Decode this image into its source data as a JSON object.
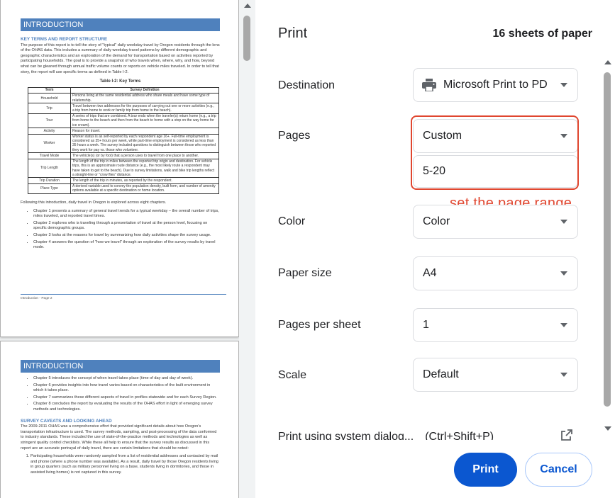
{
  "dialog": {
    "title": "Print",
    "sheets": "16 sheets of paper"
  },
  "settings": {
    "destination": {
      "label": "Destination",
      "value": "Microsoft Print to PD"
    },
    "pages": {
      "label": "Pages",
      "value": "Custom",
      "range": "5-20"
    },
    "color": {
      "label": "Color",
      "value": "Color"
    },
    "paper_size": {
      "label": "Paper size",
      "value": "A4"
    },
    "pages_per_sheet": {
      "label": "Pages per sheet",
      "value": "1"
    },
    "scale": {
      "label": "Scale",
      "value": "Default"
    },
    "system_dialog": {
      "label": "Print using system dialog...",
      "shortcut": "(Ctrl+Shift+P)"
    }
  },
  "annotation": {
    "text": "set the page range",
    "color": "#e0462f"
  },
  "buttons": {
    "print": "Print",
    "cancel": "Cancel"
  },
  "colors": {
    "accent": "#0b57d0",
    "doc_heading": "#4f81bd"
  },
  "preview": {
    "page1": {
      "banner": "INTRODUCTION",
      "heading": "KEY TERMS AND REPORT STRUCTURE",
      "para1": "The purpose of this report is to tell the story of \"typical\" daily weekday travel by Oregon residents through the lens of the OHAS data. This includes a summary of daily weekday travel patterns by different demographic and geographic characteristics and an exploration of the demand for transportation based on activities reported by participating households. The goal is to provide a snapshot of who travels when, where, why, and how, beyond what can be gleaned through annual traffic volume counts or reports on vehicle miles traveled. In order to tell that story, the report will use specific terms as defined in Table I-2.",
      "table_caption": "Table I-2:  Key Terms",
      "table_headers": [
        "Term",
        "Survey Definition"
      ],
      "table_rows": [
        [
          "Household",
          "Persons living at the same residential address who share meals and have some type of relationship."
        ],
        [
          "Trip",
          "Travel between two addresses for the purposes of carrying out one or more activities (e.g., a trip from home to work or family trip from home to the beach)."
        ],
        [
          "Tour",
          "A series of trips that are combined. A tour ends when the traveler(s) return home (e.g., a trip from home to the beach and then from the beach to home with a stop on the way home for ice cream)."
        ],
        [
          "Activity",
          "Reason for travel."
        ],
        [
          "Worker",
          "Worker status is as self-reported by each respondent age 16+. Full-time employment is considered as 35+ hours per week, while part-time employment is considered as less than 35 hours a week. The survey included questions to distinguish between those who reported they work for pay vs. those who volunteer."
        ],
        [
          "Travel Mode",
          "The vehicle(s) (or by foot) that a person uses to travel from one place to another."
        ],
        [
          "Trip Length",
          "The length of the trip in miles between the reported trip origin and destination. For vehicle trips, this is an approximate route distance (e.g., the most likely route a respondent may have taken to get to the beach). Due to survey limitations, walk and bike trip lengths reflect a straight-line or \"crow flies\" distance."
        ],
        [
          "Trip Duration",
          "The length of the trip in minutes, as reported by the respondent."
        ],
        [
          "Place Type",
          "A derived variable used to convey the population density, built form, and number of amenity options available at a specific destination or home location."
        ]
      ],
      "para2": "Following this introduction, daily travel in Oregon is explored across eight chapters.",
      "bullets": [
        "Chapter 1 presents a summary of general travel trends for a typical weekday – the overall number of trips, miles traveled, and reported travel times.",
        "Chapter 2 explores who is traveling through a presentation of travel at the person level, focusing on specific demographic groups.",
        "Chapter 3 looks at the reasons for travel by summarizing how daily activities shape the survey usage.",
        "Chapter 4 answers the question of \"how we travel\" through an exploration of the survey results by travel mode."
      ],
      "footer": "Introduction - Page 2"
    },
    "page2": {
      "banner": "INTRODUCTION",
      "bullets": [
        "Chapter 5 introduces the concept of when travel takes place (time of day and day of week).",
        "Chapter 6 provides insights into how travel varies based on characteristics of the built environment in which it takes place.",
        "Chapter 7 summarizes these different aspects of travel in profiles statewide and for each Survey Region.",
        "Chapter 8 concludes the report by evaluating the results of the OHAS effort in light of emerging survey methods and technologies."
      ],
      "heading": "SURVEY CAVEATS AND LOOKING AHEAD",
      "para1": "The 2009-2011 OHAS was a comprehensive effort that provided significant details about how Oregon's transportation infrastructure is used. The survey methods, sampling, and post-processing of the data conformed to industry standards. These included the use of state-of-the-practice methods and technologies as well as stringent quality control checklists. While these all help to ensure that the survey results as discussed in this report are an accurate portrayal of daily travel, there are certain limitations that should be noted:",
      "numbered": [
        "Participating households were randomly sampled from a list of residential addresses and contacted by mail and phone (where a phone number was available). As a result, daily travel by those Oregon residents living in group quarters (such as military personnel living on a base, students living in dormitories, and those in assisted living homes) is not captured in this survey."
      ]
    }
  }
}
